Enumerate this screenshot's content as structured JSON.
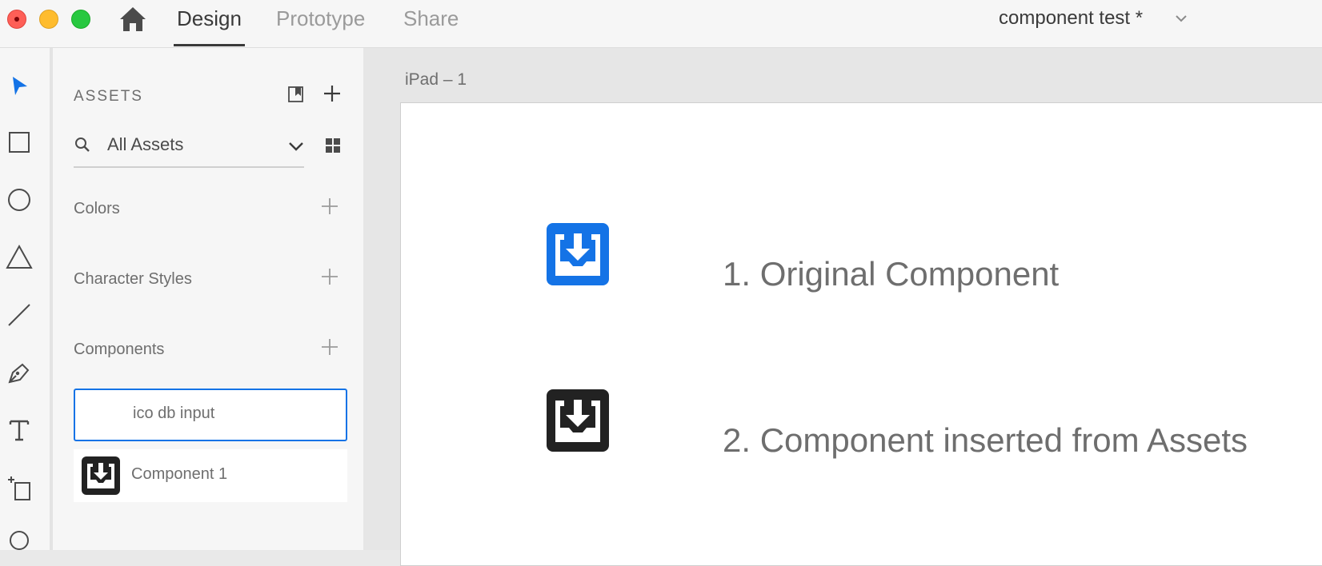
{
  "window": {
    "tabs": [
      {
        "label": "Design",
        "active": true
      },
      {
        "label": "Prototype",
        "active": false
      },
      {
        "label": "Share",
        "active": false
      }
    ],
    "document_title": "component test *"
  },
  "toolbar": {
    "tools": [
      "select-tool",
      "rectangle-tool",
      "ellipse-tool",
      "polygon-tool",
      "line-tool",
      "pen-tool",
      "text-tool",
      "artboard-tool",
      "zoom-tool"
    ]
  },
  "assets": {
    "title": "ASSETS",
    "search_label": "All Assets",
    "sections": {
      "colors": "Colors",
      "character_styles": "Character Styles",
      "components": "Components"
    },
    "components": [
      {
        "name": "ico db input",
        "selected": true
      },
      {
        "name": "Component 1",
        "selected": false
      }
    ]
  },
  "canvas": {
    "artboard_name": "iPad – 1",
    "items": [
      {
        "text": "1. Original Component",
        "icon_color": "#1473e6"
      },
      {
        "text": "2. Component inserted from Assets",
        "icon_color": "#222222"
      }
    ]
  },
  "colors": {
    "accent": "#1473e6",
    "dark_icon": "#222222"
  }
}
